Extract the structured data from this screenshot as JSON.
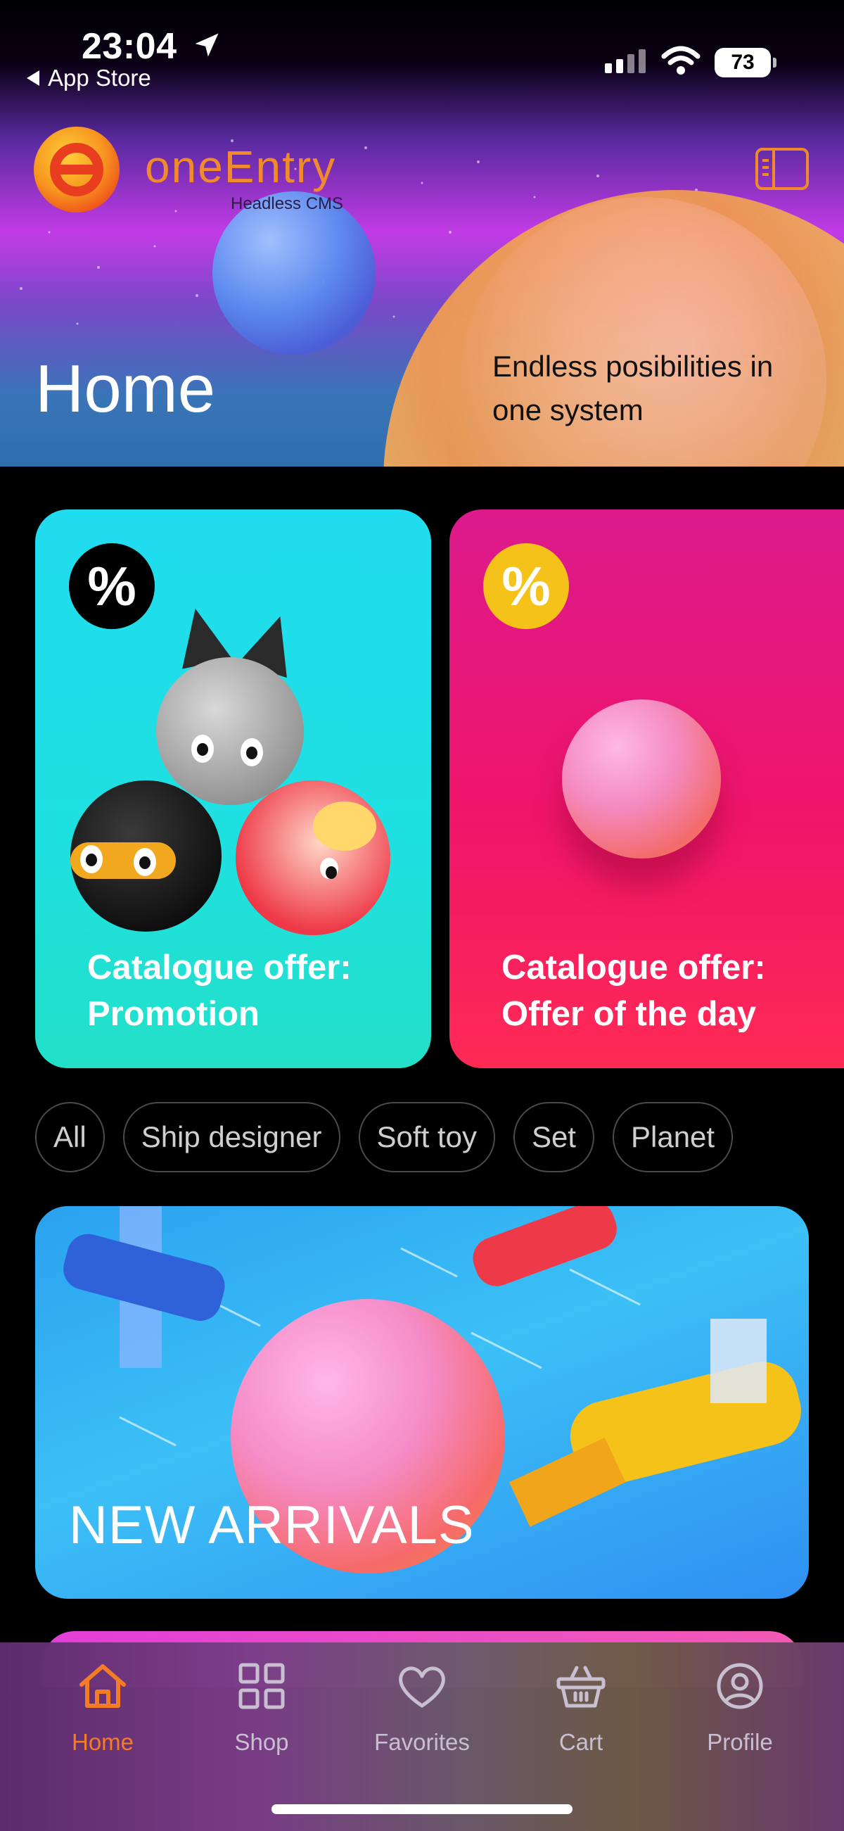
{
  "status_bar": {
    "time": "23:04",
    "back_label": "App Store",
    "battery": "73"
  },
  "brand": {
    "name": "oneEntry",
    "subtitle": "Headless CMS",
    "accent": "#f08a2a"
  },
  "header": {
    "title": "Home",
    "tagline": "Endless posibilities in one system"
  },
  "offers": [
    {
      "badge": "%",
      "title": "Catalogue offer: Promotion",
      "color": "#20dcef",
      "badge_color": "#000000"
    },
    {
      "badge": "%",
      "title": "Catalogue offer: Offer of the day",
      "color": "#f0146a",
      "badge_color": "#f4c219"
    }
  ],
  "filters": [
    "All",
    "Ship designer",
    "Soft toy",
    "Set",
    "Planet"
  ],
  "banner": {
    "title": "NEW ARRIVALS"
  },
  "tabbar": {
    "active": "Home",
    "active_color": "#f57c26",
    "items": [
      {
        "label": "Home",
        "icon": "home-icon"
      },
      {
        "label": "Shop",
        "icon": "grid-icon"
      },
      {
        "label": "Favorites",
        "icon": "heart-icon"
      },
      {
        "label": "Cart",
        "icon": "basket-icon"
      },
      {
        "label": "Profile",
        "icon": "user-circle-icon"
      }
    ]
  }
}
